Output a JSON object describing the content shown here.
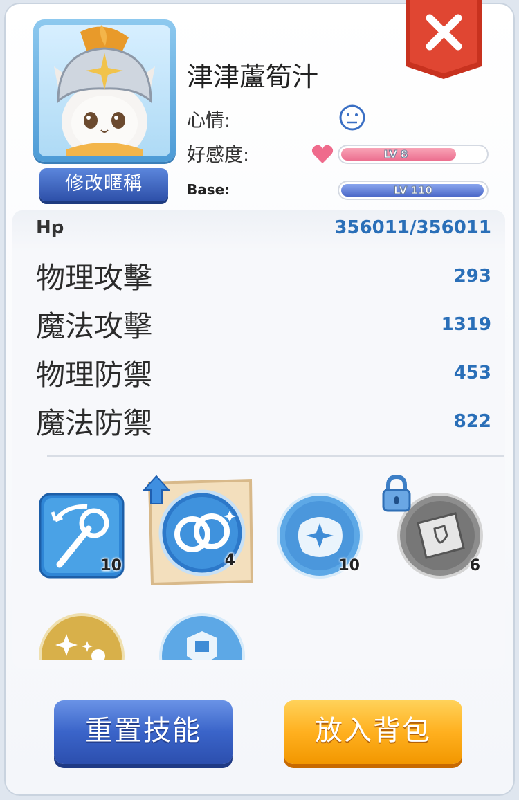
{
  "profile": {
    "name": "津津蘆筍汁",
    "rename_label": "修改暱稱",
    "mood_label": "心情:",
    "favor_label": "好感度:",
    "base_label": "Base:",
    "favor_level": "LV 8",
    "base_level": "LV 110"
  },
  "stats": {
    "hp_label": "Hp",
    "hp_value": "356011/356011",
    "rows": [
      {
        "label": "物理攻擊",
        "value": "293"
      },
      {
        "label": "魔法攻擊",
        "value": "1319"
      },
      {
        "label": "物理防禦",
        "value": "453"
      },
      {
        "label": "魔法防禦",
        "value": "822"
      }
    ]
  },
  "skills": [
    {
      "icon": "staff-icon",
      "level": "10"
    },
    {
      "icon": "rings-icon",
      "level": "4"
    },
    {
      "icon": "burst-icon",
      "level": "10"
    },
    {
      "icon": "book-icon",
      "level": "6"
    }
  ],
  "actions": {
    "reset_label": "重置技能",
    "store_label": "放入背包"
  },
  "colors": {
    "accent_blue": "#2a6fb8",
    "close_red": "#d93b2a",
    "favor_pink": "#f08aa3",
    "base_blue": "#5b79d6"
  }
}
